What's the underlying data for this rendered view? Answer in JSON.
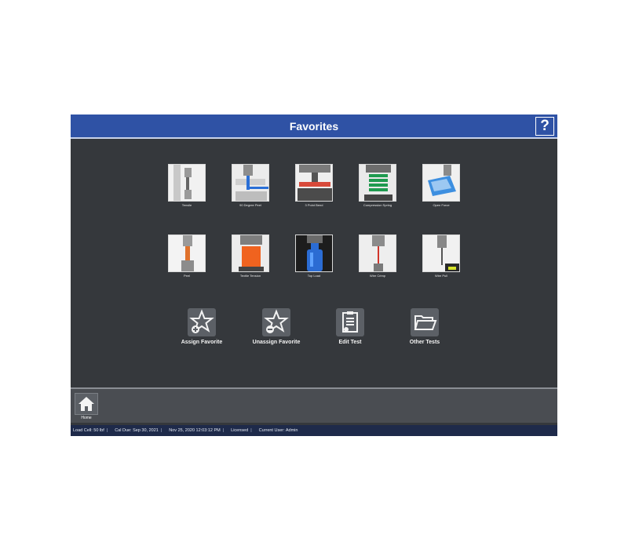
{
  "app": {
    "title": "Favorites",
    "help_label": "?"
  },
  "favorites": [
    {
      "label": "Tensile",
      "icon": "tensile-test-icon"
    },
    {
      "label": "90 Degree Peel",
      "icon": "peel-test-icon"
    },
    {
      "label": "3 Point Bend",
      "icon": "bend-test-icon"
    },
    {
      "label": "Compression Spring",
      "icon": "spring-test-icon"
    },
    {
      "label": "Open Force",
      "icon": "open-force-icon"
    },
    {
      "label": "Peel",
      "icon": "peel-icon"
    },
    {
      "label": "Textile Tension",
      "icon": "textile-tension-icon"
    },
    {
      "label": "Top Load",
      "icon": "top-load-icon"
    },
    {
      "label": "Wire Crimp",
      "icon": "wire-crimp-icon"
    },
    {
      "label": "Wire Pull",
      "icon": "wire-pull-icon"
    }
  ],
  "actions": {
    "assign": {
      "label": "Assign Favorite",
      "icon": "star-plus-icon"
    },
    "unassign": {
      "label": "Unassign Favorite",
      "icon": "star-minus-icon"
    },
    "edit": {
      "label": "Edit Test",
      "icon": "clipboard-edit-icon"
    },
    "other": {
      "label": "Other Tests",
      "icon": "folder-open-icon"
    }
  },
  "nav": {
    "home_label": "Home",
    "home_icon": "home-icon"
  },
  "status": {
    "load_cell": "Load Cell: 50 lbf",
    "cal_due": "Cal Due: Sep 30, 2021",
    "datetime": "Nov 25, 2020 12:03:12 PM",
    "license": "Licensed",
    "user": "Current User: Admin",
    "separator": "|"
  },
  "colors": {
    "title_bar": "#2f52a5",
    "background": "#35383c",
    "status_bar": "#1e2a4a"
  }
}
